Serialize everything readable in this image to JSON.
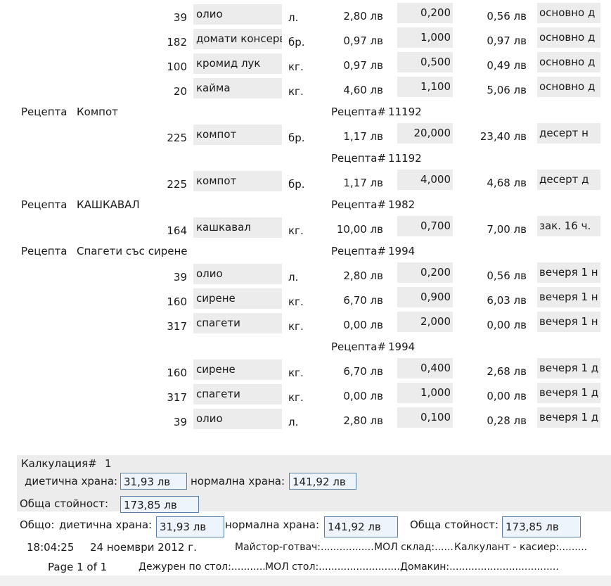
{
  "rows": [
    {
      "code": "39",
      "name": "олио",
      "unit": "л.",
      "price": "2,80 лв",
      "qty": "0,200",
      "total": "0,56 лв",
      "note": "основно д"
    },
    {
      "code": "182",
      "name": "домати консерв",
      "unit": "бр.",
      "price": "0,97 лв",
      "qty": "1,000",
      "total": "0,97 лв",
      "note": "основно д"
    },
    {
      "code": "100",
      "name": "кромид лук",
      "unit": "кг.",
      "price": "0,97 лв",
      "qty": "0,500",
      "total": "0,49 лв",
      "note": "основно д"
    },
    {
      "code": "20",
      "name": "кайма",
      "unit": "кг.",
      "price": "4,60 лв",
      "qty": "1,100",
      "total": "5,06 лв",
      "note": "основно д"
    },
    {
      "code": "225",
      "name": "компот",
      "unit": "бр.",
      "price": "1,17 лв",
      "qty": "20,000",
      "total": "23,40 лв",
      "note": "десерт н"
    },
    {
      "code": "225",
      "name": "компот",
      "unit": "бр.",
      "price": "1,17 лв",
      "qty": "4,000",
      "total": "4,68 лв",
      "note": "десерт д"
    },
    {
      "code": "164",
      "name": "кашкавал",
      "unit": "кг.",
      "price": "10,00 лв",
      "qty": "0,700",
      "total": "7,00 лв",
      "note": "зак. 16 ч."
    },
    {
      "code": "39",
      "name": "олио",
      "unit": "л.",
      "price": "2,80 лв",
      "qty": "0,200",
      "total": "0,56 лв",
      "note": "вечеря 1 н"
    },
    {
      "code": "160",
      "name": "сирене",
      "unit": "кг.",
      "price": "6,70 лв",
      "qty": "0,900",
      "total": "6,03 лв",
      "note": "вечеря 1 н"
    },
    {
      "code": "317",
      "name": "спагети",
      "unit": "кг.",
      "price": "0,00 лв",
      "qty": "2,000",
      "total": "0,00 лв",
      "note": "вечеря 1 н"
    },
    {
      "code": "160",
      "name": "сирене",
      "unit": "кг.",
      "price": "6,70 лв",
      "qty": "0,400",
      "total": "2,68 лв",
      "note": "вечеря 1 д"
    },
    {
      "code": "317",
      "name": "спагети",
      "unit": "кг.",
      "price": "0,00 лв",
      "qty": "1,000",
      "total": "0,00 лв",
      "note": "вечеря 1 д"
    },
    {
      "code": "39",
      "name": "олио",
      "unit": "л.",
      "price": "2,80 лв",
      "qty": "0,100",
      "total": "0,28 лв",
      "note": "вечеря 1 д"
    }
  ],
  "recipe_label": "Рецепта",
  "recipe_no_label": "Рецепта#",
  "recipes": [
    {
      "name": "Компот",
      "number": "11192"
    },
    {
      "name": "",
      "number": "11192"
    },
    {
      "name": "КАШКАВАЛ",
      "number": "1982"
    },
    {
      "name": "Спагети със сирене",
      "number": "1994"
    },
    {
      "name": "",
      "number": "1994"
    }
  ],
  "calc": {
    "label": "Калкулация#",
    "number": "1",
    "diet_label": "диетична храна:",
    "diet_value": "31,93 лв",
    "normal_label": "нормална храна:",
    "normal_value": "141,92 лв",
    "total_label": "Обща стойност:",
    "total_value": "173,85 лв"
  },
  "grand": {
    "label": "Общо:",
    "diet_label": "диетична храна:",
    "diet_value": "31,93 лв",
    "normal_label": "нормална храна:",
    "normal_value": "141,92 лв",
    "total_label": "Обща стойност:",
    "total_value": "173,85 лв"
  },
  "footer": {
    "time": "18:04:25",
    "date": "24 ноември 2012 г.",
    "chef": "Майстор-готвач:.................",
    "mol_warehouse": "МОЛ склад:......",
    "calculator": "Калкулант - касиер:.........",
    "page": "Page 1 of 1",
    "duty": "Дежурен по стол:...........",
    "mol_canteen": "МОЛ стол:...........................",
    "housekeeper": "Домакин:..................................."
  }
}
